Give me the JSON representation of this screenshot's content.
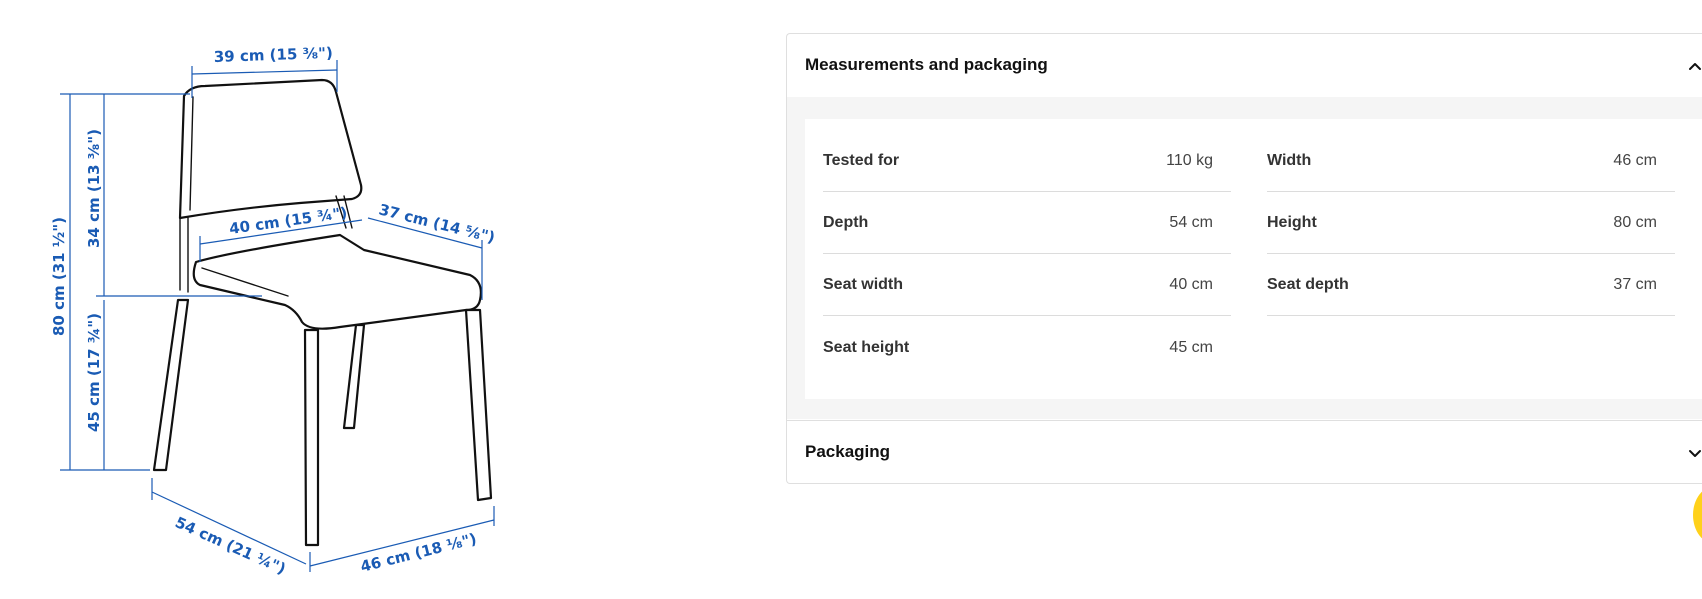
{
  "diagram": {
    "labels": {
      "back_width": "39 cm (15 ⅜\")",
      "total_height": "80 cm (31 ½\")",
      "back_height": "34 cm (13 ⅜\")",
      "seat_height": "45 cm (17 ¾\")",
      "seat_width": "40 cm (15 ¾\")",
      "seat_depth": "37 cm (14 ⅝\")",
      "depth": "54 cm (21 ¼\")",
      "width": "46 cm (18 ⅛\")"
    },
    "colors": {
      "dimension": "#1a5bb4",
      "line": "#111111"
    }
  },
  "panel": {
    "measurements_title": "Measurements and packaging",
    "measurements_expanded": true,
    "packaging_title": "Packaging",
    "packaging_expanded": false,
    "rows": [
      {
        "label": "Tested for",
        "value": "110 kg"
      },
      {
        "label": "Width",
        "value": "46 cm"
      },
      {
        "label": "Depth",
        "value": "54 cm"
      },
      {
        "label": "Height",
        "value": "80 cm"
      },
      {
        "label": "Seat width",
        "value": "40 cm"
      },
      {
        "label": "Seat depth",
        "value": "37 cm"
      },
      {
        "label": "Seat height",
        "value": "45 cm"
      }
    ],
    "icons": {
      "expanded": "chevron-up-icon",
      "collapsed": "chevron-down-icon"
    }
  },
  "help_button": {
    "color": "#ffd11a"
  }
}
